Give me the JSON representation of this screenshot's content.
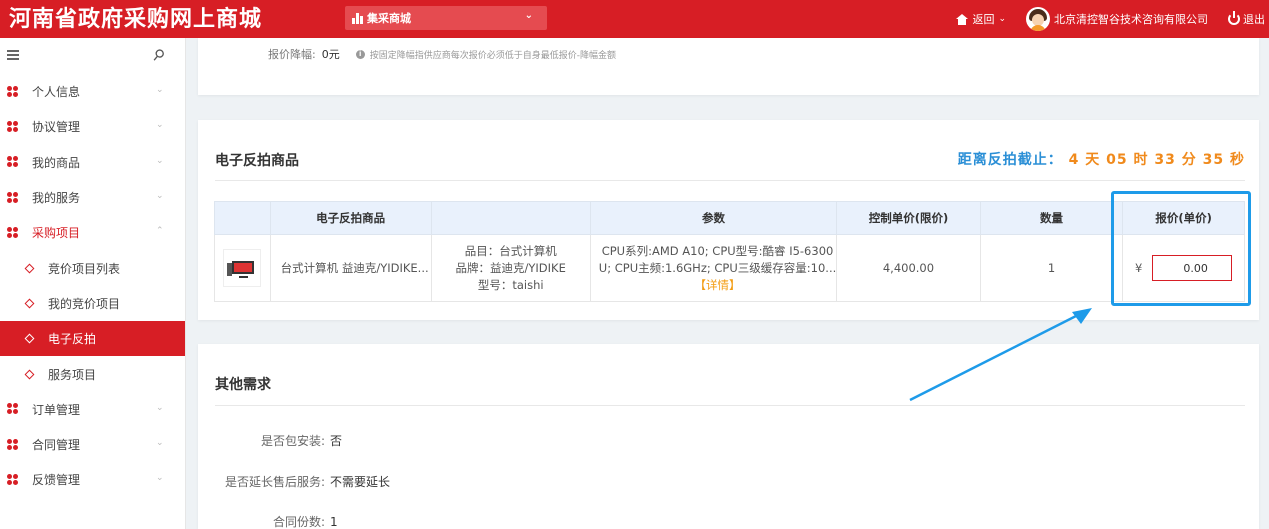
{
  "header": {
    "brand": "河南省政府采购网上商城",
    "mall_select": "集采商城",
    "back_label": "返回",
    "company": "北京清控智谷技术咨询有限公司",
    "logout_label": "退出"
  },
  "sidebar": {
    "items": [
      {
        "label": "个人信息"
      },
      {
        "label": "协议管理"
      },
      {
        "label": "我的商品"
      },
      {
        "label": "我的服务"
      },
      {
        "label": "采购项目"
      },
      {
        "label": "竞价项目列表"
      },
      {
        "label": "我的竞价项目"
      },
      {
        "label": "电子反拍"
      },
      {
        "label": "服务项目"
      },
      {
        "label": "订单管理"
      },
      {
        "label": "合同管理"
      },
      {
        "label": "反馈管理"
      }
    ]
  },
  "reduction": {
    "label": "报价降幅:",
    "value": "0元",
    "tip": "按固定降幅指供应商每次报价必须低于自身最低报价-降幅金额"
  },
  "auction": {
    "title": "电子反拍商品",
    "countdown_label": "距离反拍截止：",
    "days": "4",
    "days_unit": "天",
    "hours": "05",
    "hours_unit": "时",
    "minutes": "33",
    "minutes_unit": "分",
    "seconds": "35",
    "seconds_unit": "秒",
    "columns": [
      "电子反拍商品",
      "",
      "参数",
      "控制单价(限价)",
      "数量",
      "报价(单价)"
    ],
    "row": {
      "name": "台式计算机 益迪克/YIDIKE...",
      "category": "品目：台式计算机",
      "brand": "品牌：益迪克/YIDIKE",
      "model": "型号：taishi",
      "params_line1": "CPU系列:AMD A10; CPU型号:酷睿 I5-6300",
      "params_line2": "U; CPU主频:1.6GHz; CPU三级缓存容量:10...",
      "detail": "【详情】",
      "control_price": "4,400.00",
      "quantity": "1",
      "currency": "¥",
      "bid_value": "0.00"
    }
  },
  "other": {
    "title": "其他需求",
    "install_label": "是否包安装:",
    "install_value": "否",
    "warranty_label": "是否延长售后服务:",
    "warranty_value": "不需要延长",
    "contracts_label": "合同份数:",
    "contracts_value": "1"
  },
  "colors": {
    "brand_red": "#d71e25",
    "countdown_blue": "#2b8fd6",
    "countdown_orange": "#f08a1c",
    "highlight_blue": "#1e9be9"
  }
}
